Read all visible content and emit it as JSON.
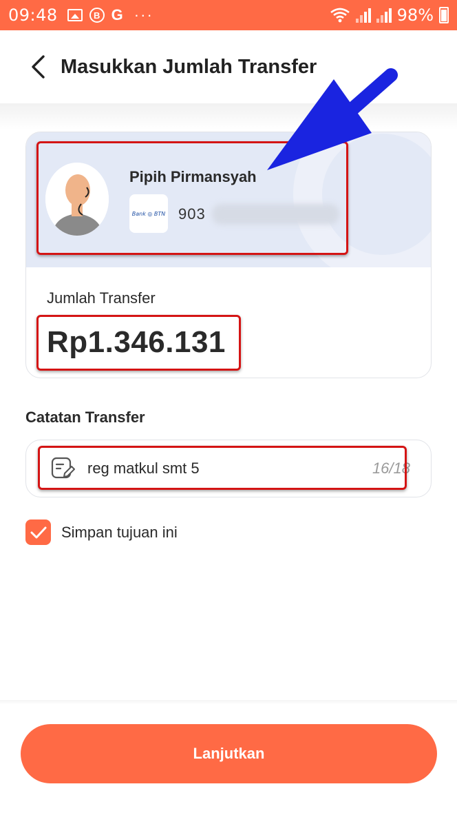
{
  "status_bar": {
    "time": "09:48",
    "battery": "98%",
    "icons": [
      "image-icon",
      "b-circle-icon",
      "g-icon",
      "more-dots-icon",
      "wifi-icon",
      "signal-icon",
      "battery-icon"
    ],
    "g_letter": "G",
    "b_letter": "B",
    "dots": "···"
  },
  "header": {
    "title": "Masukkan Jumlah Transfer"
  },
  "recipient": {
    "name": "Pipih Pirmansyah",
    "bank_logo_text": "Bank ◎ BTN",
    "account_prefix": "903"
  },
  "amount": {
    "label": "Jumlah Transfer",
    "value": "Rp1.346.131"
  },
  "note": {
    "label": "Catatan Transfer",
    "value": "reg matkul smt 5",
    "counter": "16/18"
  },
  "save_destination": {
    "label": "Simpan tujuan ini",
    "checked": true
  },
  "continue_button": {
    "label": "Lanjutkan"
  },
  "colors": {
    "accent": "#ff6a45",
    "card_top": "#e3e9f6",
    "annotation_box": "#d41414",
    "annotation_arrow": "#1a24e0"
  }
}
